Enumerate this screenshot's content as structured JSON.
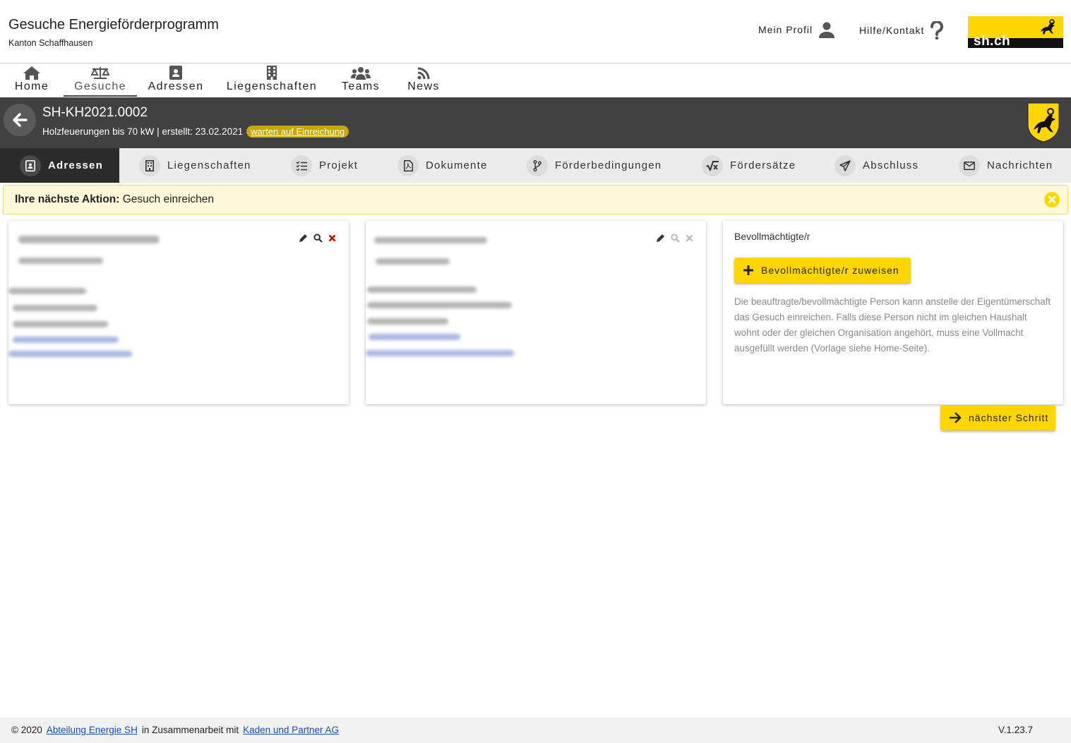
{
  "header": {
    "title": "Gesuche Energieförderprogramm",
    "subtitle": "Kanton Schaffhausen",
    "profile_label": "Mein Profil",
    "help_label": "Hilfe/Kontakt",
    "logo_text": "sh.ch"
  },
  "mainnav": {
    "items": [
      {
        "label": "Home",
        "icon": "home-icon"
      },
      {
        "label": "Gesuche",
        "icon": "scale-icon"
      },
      {
        "label": "Adressen",
        "icon": "address-book-icon"
      },
      {
        "label": "Liegenschaften",
        "icon": "building-icon"
      },
      {
        "label": "Teams",
        "icon": "users-icon"
      },
      {
        "label": "News",
        "icon": "rss-icon"
      }
    ],
    "active": "Gesuche"
  },
  "request": {
    "id": "SH-KH2021.0002",
    "description": "Holzfeuerungen bis 70 kW | erstellt: 23.02.2021",
    "status": "warten auf Einreichung"
  },
  "subtabs": {
    "items": [
      {
        "label": "Adressen",
        "icon": "address-book-icon"
      },
      {
        "label": "Liegenschaften",
        "icon": "building-icon"
      },
      {
        "label": "Projekt",
        "icon": "checklist-icon"
      },
      {
        "label": "Dokumente",
        "icon": "pdf-file-icon"
      },
      {
        "label": "Förderbedingungen",
        "icon": "branch-icon"
      },
      {
        "label": "Fördersätze",
        "icon": "square-root-icon"
      },
      {
        "label": "Abschluss",
        "icon": "paper-plane-icon"
      },
      {
        "label": "Nachrichten",
        "icon": "envelope-icon"
      }
    ],
    "active": "Adressen"
  },
  "banner": {
    "label": "Ihre nächste Aktion:",
    "action": "Gesuch einreichen"
  },
  "cards": {
    "authorized": {
      "title": "Bevollmächtigte/r",
      "assign_button": "Bevollmächtigte/r zuweisen",
      "description": "Die beauftragte/bevollmächtigte Person kann anstelle der Eigentümerschaft das Gesuch einreichen. Falls diese Person nicht im gleichen Haushalt wohnt oder der gleichen Organisation angehört, muss eine Vollmacht ausgefüllt werden (Vorlage siehe Home-Seite)."
    }
  },
  "next_button": "nächster Schritt",
  "footer": {
    "copyright": "© 2020",
    "link1": "Abteilung Energie SH",
    "middle": "in Zusammenarbeit mit",
    "link2": "Kaden und Partner AG",
    "version": "V.1.23.7"
  },
  "colors": {
    "accent": "#ffd600",
    "dark": "#414141",
    "delete": "#d00000"
  }
}
